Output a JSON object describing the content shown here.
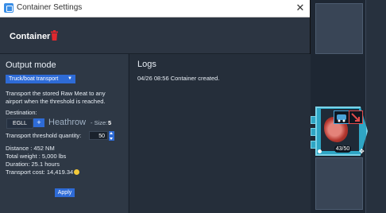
{
  "window": {
    "title": "Container Settings",
    "close_glyph": "✕"
  },
  "header": {
    "title": "Container"
  },
  "output": {
    "heading": "Output mode",
    "mode_selected": "Truck/boat transport",
    "description": [
      "Transport the stored Raw Meat to any",
      "airport when the threshold is reached."
    ],
    "destination_label": "Destination:",
    "airport_code": "EGLL",
    "plus_label": "+",
    "airport_name": "Heathrow",
    "size_label": "- Size:",
    "size_value": "5",
    "threshold_label": "Transport threshold quantity:",
    "threshold_value": "50",
    "stats": {
      "distance": "Distance : 452 NM",
      "weight": "Total weight : 5,000 lbs",
      "duration": "Duration: 25.1 hours",
      "cost": "Transport cost:  14,419.34"
    },
    "apply_label": "Apply"
  },
  "logs": {
    "heading": "Logs",
    "entries": [
      "04/26 08:56 Container created."
    ]
  },
  "widget": {
    "count": "43/50"
  },
  "colors": {
    "accent": "#2e6bd6",
    "danger": "#e0282e",
    "coin": "#f3c93a",
    "widget": "#2fa5c4"
  }
}
